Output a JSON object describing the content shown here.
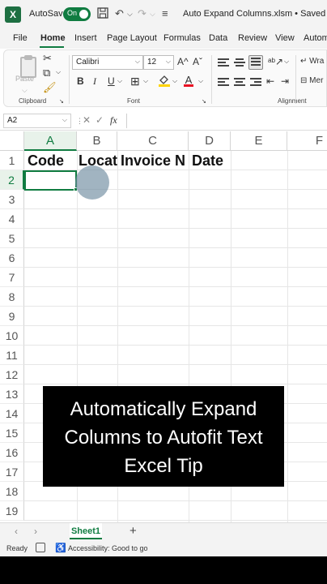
{
  "titlebar": {
    "autosave_label": "AutoSave",
    "autosave_state": "On",
    "document_title": "Auto Expand Columns.xlsm • Saved",
    "title_caret": "⌵"
  },
  "ribbon_tabs": [
    "File",
    "Home",
    "Insert",
    "Page Layout",
    "Formulas",
    "Data",
    "Review",
    "View",
    "Autom"
  ],
  "ribbon": {
    "paste_label": "Paste",
    "font_name": "Calibri",
    "font_size": "12",
    "grow_font": "A^",
    "shrink_font": "Aˇ",
    "bold": "B",
    "italic": "I",
    "underline": "U",
    "font_color_letter": "A",
    "wrap_label": "Wra",
    "merge_label": "Mer",
    "groups": {
      "clipboard": "Clipboard",
      "font": "Font",
      "alignment": "Alignment"
    }
  },
  "formula_bar": {
    "name_box": "A2",
    "cancel": "✕",
    "enter": "✓",
    "fx": "fx",
    "value": ""
  },
  "grid": {
    "columns": [
      "A",
      "B",
      "C",
      "D",
      "E",
      "F"
    ],
    "rows": [
      "1",
      "2",
      "3",
      "4",
      "5",
      "6",
      "7",
      "8",
      "9",
      "10",
      "11",
      "12",
      "13",
      "14",
      "15",
      "16",
      "17",
      "18",
      "19"
    ],
    "row1": {
      "A": "Code",
      "B": "Locat",
      "C": "Invoice N",
      "D": "Date"
    },
    "selected_cell": "A2"
  },
  "caption": {
    "line1": "Automatically Expand",
    "line2": "Columns to Autofit Text",
    "line3": "Excel Tip"
  },
  "sheets": {
    "tabs": [
      "Sheet1"
    ],
    "add": "+"
  },
  "status": {
    "ready": "Ready",
    "accessibility": "Accessibility: Good to go"
  },
  "colors": {
    "excel_green": "#107c41",
    "caption_bg": "#000000"
  }
}
